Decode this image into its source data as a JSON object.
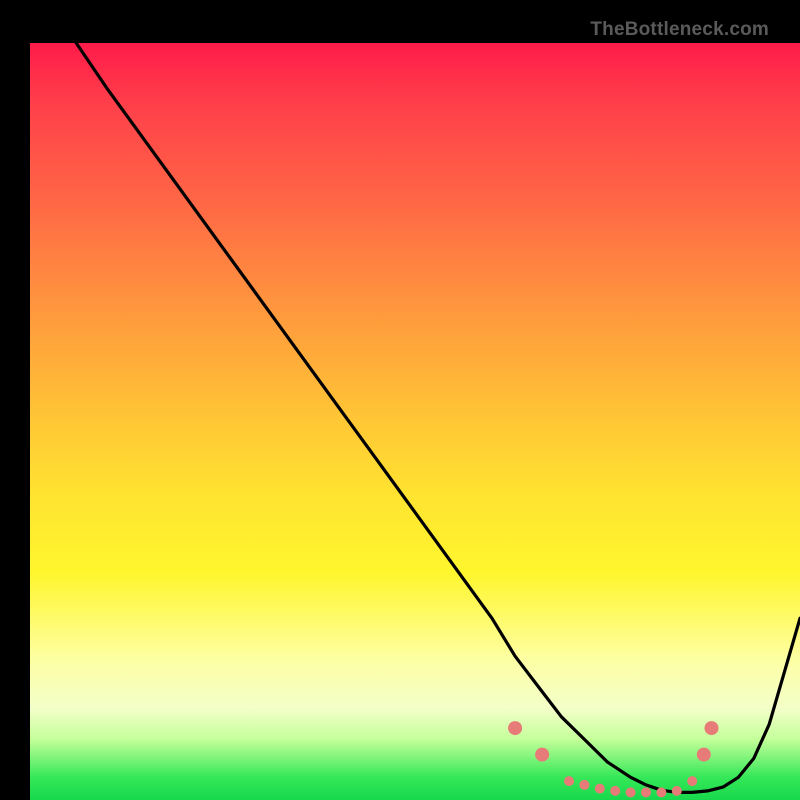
{
  "watermark": "TheBottleneck.com",
  "chart_data": {
    "type": "line",
    "title": "",
    "xlabel": "",
    "ylabel": "",
    "xlim": [
      0,
      100
    ],
    "ylim": [
      0,
      100
    ],
    "grid": false,
    "series": [
      {
        "name": "bottleneck-curve",
        "color": "#000000",
        "x": [
          6,
          10,
          15,
          20,
          25,
          30,
          35,
          40,
          45,
          50,
          55,
          60,
          63,
          66,
          69,
          72,
          75,
          78,
          80,
          82,
          84,
          86,
          88,
          90,
          92,
          94,
          96,
          98,
          100
        ],
        "y": [
          100,
          94,
          87,
          80,
          73,
          66,
          59,
          52,
          45,
          38,
          31,
          24,
          19,
          15,
          11,
          8,
          5,
          3,
          2,
          1.3,
          1,
          1,
          1.2,
          1.7,
          3,
          5.5,
          10,
          17,
          24
        ]
      }
    ],
    "markers": {
      "name": "bottom-dots",
      "color": "#e77b78",
      "radius_small": 5,
      "radius_large": 7,
      "points_x": [
        63,
        66.5,
        70,
        72,
        74,
        76,
        78,
        80,
        82,
        84,
        86,
        87.5,
        88.5
      ],
      "points_y": [
        9.5,
        6,
        2.5,
        2,
        1.5,
        1.2,
        1,
        1,
        1,
        1.2,
        2.5,
        6,
        9.5
      ],
      "large_indices": [
        0,
        1,
        11,
        12
      ]
    }
  }
}
